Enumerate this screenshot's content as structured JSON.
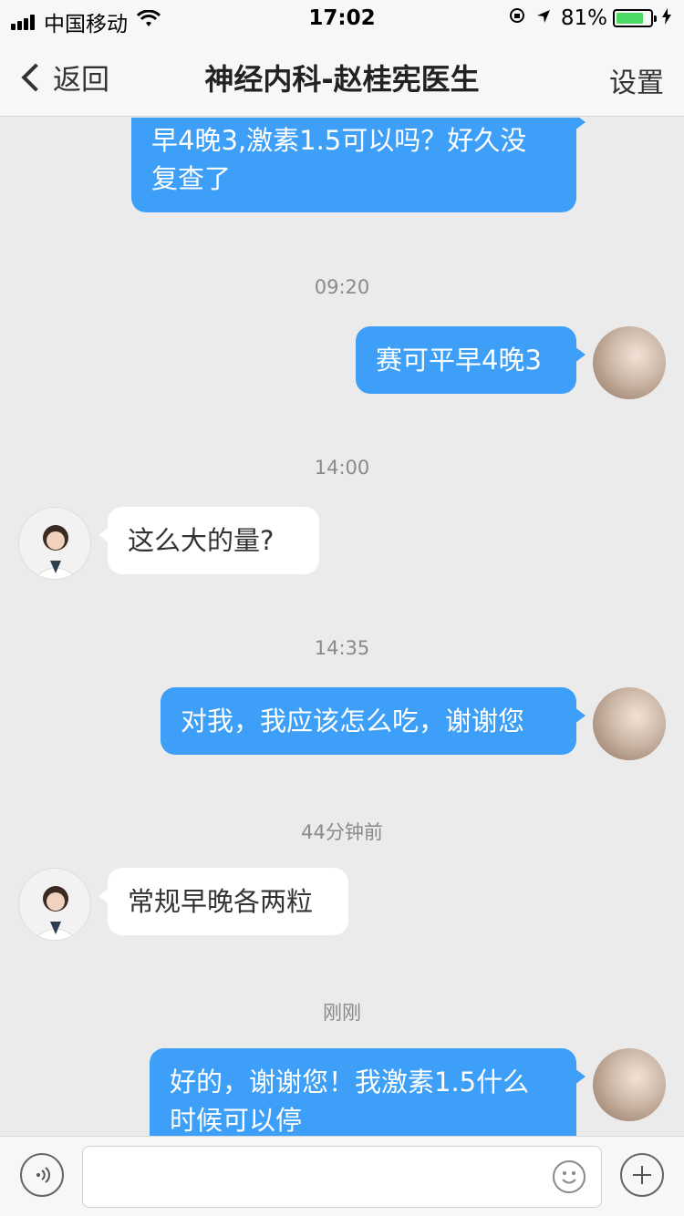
{
  "status_bar": {
    "carrier": "中国移动",
    "time": "17:02",
    "battery_percent": "81%",
    "battery_level": 0.81
  },
  "nav": {
    "back_label": "返回",
    "title": "神经内科-赵桂宪医生",
    "right_label": "设置"
  },
  "messages": [
    {
      "type": "me",
      "text_lines": [
        "早4晚3,激素1.5可以吗？好久没",
        "复查了"
      ]
    },
    {
      "type": "time",
      "text": "09:20"
    },
    {
      "type": "me",
      "text": "赛可平早4晚3"
    },
    {
      "type": "time",
      "text": "14:00"
    },
    {
      "type": "doc",
      "text": "这么大的量?"
    },
    {
      "type": "time",
      "text": "14:35"
    },
    {
      "type": "me",
      "text": "对我，我应该怎么吃，谢谢您"
    },
    {
      "type": "time",
      "text": "44分钟前"
    },
    {
      "type": "doc",
      "text": "常规早晚各两粒"
    },
    {
      "type": "time",
      "text": "刚刚"
    },
    {
      "type": "me",
      "text_lines": [
        "好的，谢谢您！我激素1.5什么",
        "时候可以停"
      ]
    }
  ],
  "input": {
    "placeholder": ""
  },
  "icons": {
    "voice": "voice-icon",
    "emoji": "emoji-icon",
    "plus": "plus-icon",
    "back": "chevron-left-icon"
  },
  "colors": {
    "my_bubble": "#3d9ff7",
    "doctor_bubble": "#ffffff",
    "background": "#ebebeb"
  }
}
